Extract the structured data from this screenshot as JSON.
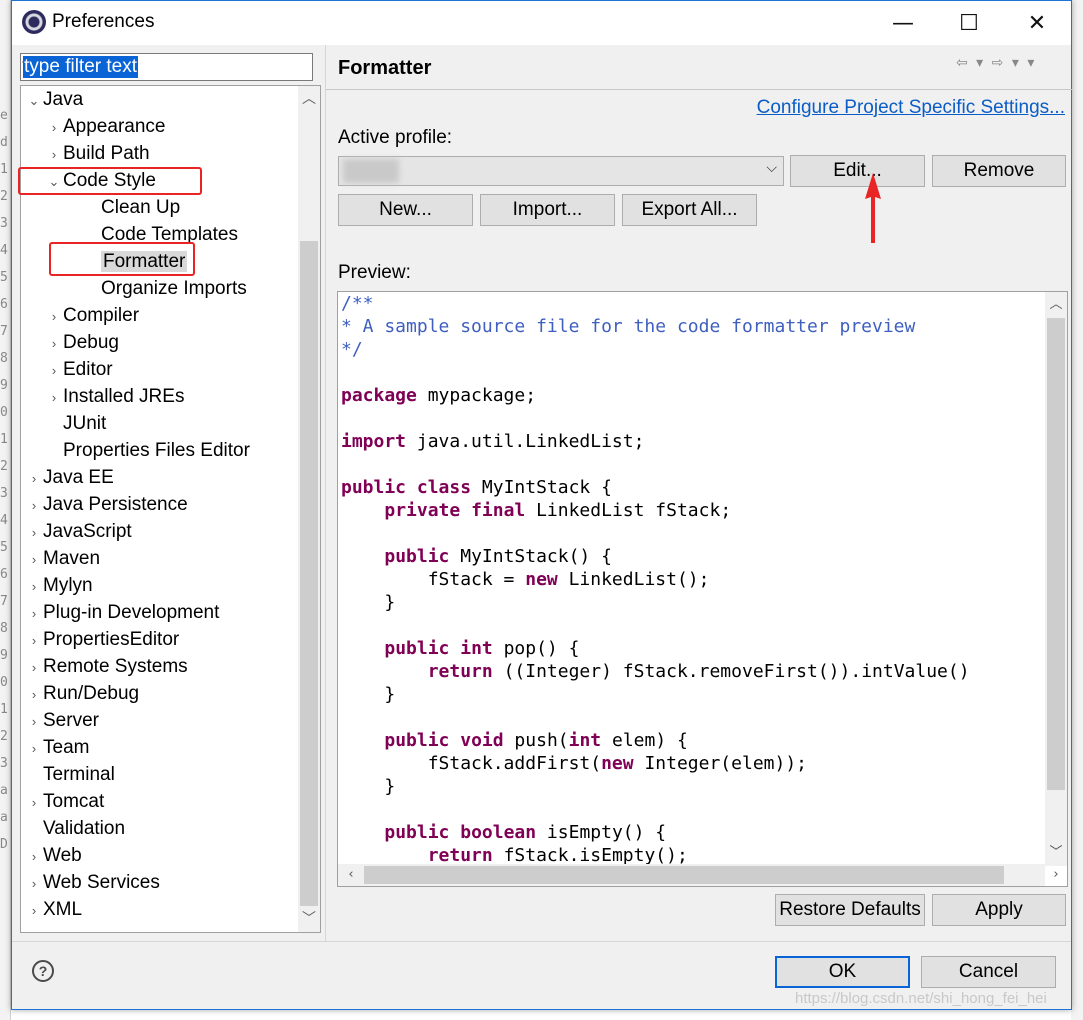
{
  "window": {
    "title": "Preferences",
    "minimize": "—",
    "maximize": "☐",
    "close": "✕"
  },
  "filter": {
    "placeholder": "type filter text",
    "value": "type filter text"
  },
  "tree": [
    {
      "label": "Java",
      "chevron": "⌄",
      "level": 0
    },
    {
      "label": "Appearance",
      "chevron": "›",
      "level": 1
    },
    {
      "label": "Build Path",
      "chevron": "›",
      "level": 1
    },
    {
      "label": "Code Style",
      "chevron": "⌄",
      "level": 1
    },
    {
      "label": "Clean Up",
      "chevron": "",
      "level": 2
    },
    {
      "label": "Code Templates",
      "chevron": "",
      "level": 2
    },
    {
      "label": "Formatter",
      "chevron": "",
      "level": 2,
      "selected": true
    },
    {
      "label": "Organize Imports",
      "chevron": "",
      "level": 2
    },
    {
      "label": "Compiler",
      "chevron": "›",
      "level": 1
    },
    {
      "label": "Debug",
      "chevron": "›",
      "level": 1
    },
    {
      "label": "Editor",
      "chevron": "›",
      "level": 1
    },
    {
      "label": "Installed JREs",
      "chevron": "›",
      "level": 1
    },
    {
      "label": "JUnit",
      "chevron": "",
      "level": 1
    },
    {
      "label": "Properties Files Editor",
      "chevron": "",
      "level": 1
    },
    {
      "label": "Java EE",
      "chevron": "›",
      "level": 0
    },
    {
      "label": "Java Persistence",
      "chevron": "›",
      "level": 0
    },
    {
      "label": "JavaScript",
      "chevron": "›",
      "level": 0
    },
    {
      "label": "Maven",
      "chevron": "›",
      "level": 0
    },
    {
      "label": "Mylyn",
      "chevron": "›",
      "level": 0
    },
    {
      "label": "Plug-in Development",
      "chevron": "›",
      "level": 0
    },
    {
      "label": "PropertiesEditor",
      "chevron": "›",
      "level": 0
    },
    {
      "label": "Remote Systems",
      "chevron": "›",
      "level": 0
    },
    {
      "label": "Run/Debug",
      "chevron": "›",
      "level": 0
    },
    {
      "label": "Server",
      "chevron": "›",
      "level": 0
    },
    {
      "label": "Team",
      "chevron": "›",
      "level": 0
    },
    {
      "label": "Terminal",
      "chevron": "",
      "level": 0
    },
    {
      "label": "Tomcat",
      "chevron": "›",
      "level": 0
    },
    {
      "label": "Validation",
      "chevron": "",
      "level": 0
    },
    {
      "label": "Web",
      "chevron": "›",
      "level": 0
    },
    {
      "label": "Web Services",
      "chevron": "›",
      "level": 0
    },
    {
      "label": "XML",
      "chevron": "›",
      "level": 0
    }
  ],
  "page": {
    "title": "Formatter",
    "nav": "⇦ ▾ ⇨ ▾ ▾",
    "configure_link": "Configure Project Specific Settings...",
    "active_profile_label": "Active profile:",
    "edit": "Edit...",
    "remove": "Remove",
    "new": "New...",
    "import": "Import...",
    "export_all": "Export All...",
    "preview_label": "Preview:"
  },
  "preview_code": [
    [
      {
        "t": "/**",
        "s": "c"
      }
    ],
    [
      {
        "t": "* A sample source file for the code formatter preview",
        "s": "c"
      }
    ],
    [
      {
        "t": "*/",
        "s": "c"
      }
    ],
    [],
    [
      {
        "t": "package",
        "s": "k"
      },
      {
        "t": " mypackage;",
        "s": ""
      }
    ],
    [],
    [
      {
        "t": "import",
        "s": "k"
      },
      {
        "t": " java.util.LinkedList;",
        "s": ""
      }
    ],
    [],
    [
      {
        "t": "public",
        "s": "k"
      },
      {
        "t": " ",
        "s": ""
      },
      {
        "t": "class",
        "s": "k"
      },
      {
        "t": " MyIntStack {",
        "s": ""
      }
    ],
    [
      {
        "t": "    ",
        "s": ""
      },
      {
        "t": "private",
        "s": "k"
      },
      {
        "t": " ",
        "s": ""
      },
      {
        "t": "final",
        "s": "k"
      },
      {
        "t": " LinkedList fStack;",
        "s": ""
      }
    ],
    [],
    [
      {
        "t": "    ",
        "s": ""
      },
      {
        "t": "public",
        "s": "k"
      },
      {
        "t": " MyIntStack() {",
        "s": ""
      }
    ],
    [
      {
        "t": "        fStack = ",
        "s": ""
      },
      {
        "t": "new",
        "s": "k"
      },
      {
        "t": " LinkedList();",
        "s": ""
      }
    ],
    [
      {
        "t": "    }",
        "s": ""
      }
    ],
    [],
    [
      {
        "t": "    ",
        "s": ""
      },
      {
        "t": "public",
        "s": "k"
      },
      {
        "t": " ",
        "s": ""
      },
      {
        "t": "int",
        "s": "k"
      },
      {
        "t": " pop() {",
        "s": ""
      }
    ],
    [
      {
        "t": "        ",
        "s": ""
      },
      {
        "t": "return",
        "s": "k"
      },
      {
        "t": " ((Integer) fStack.removeFirst()).intValue()",
        "s": ""
      }
    ],
    [
      {
        "t": "    }",
        "s": ""
      }
    ],
    [],
    [
      {
        "t": "    ",
        "s": ""
      },
      {
        "t": "public",
        "s": "k"
      },
      {
        "t": " ",
        "s": ""
      },
      {
        "t": "void",
        "s": "k"
      },
      {
        "t": " push(",
        "s": ""
      },
      {
        "t": "int",
        "s": "k"
      },
      {
        "t": " elem) {",
        "s": ""
      }
    ],
    [
      {
        "t": "        fStack.addFirst(",
        "s": ""
      },
      {
        "t": "new",
        "s": "k"
      },
      {
        "t": " Integer(elem));",
        "s": ""
      }
    ],
    [
      {
        "t": "    }",
        "s": ""
      }
    ],
    [],
    [
      {
        "t": "    ",
        "s": ""
      },
      {
        "t": "public",
        "s": "k"
      },
      {
        "t": " ",
        "s": ""
      },
      {
        "t": "boolean",
        "s": "k"
      },
      {
        "t": " isEmpty() {",
        "s": ""
      }
    ],
    [
      {
        "t": "        ",
        "s": ""
      },
      {
        "t": "return",
        "s": "k"
      },
      {
        "t": " fStack.isEmpty();",
        "s": ""
      }
    ]
  ],
  "footer": {
    "restore_defaults": "Restore Defaults",
    "apply": "Apply",
    "ok": "OK",
    "cancel": "Cancel",
    "help": "?",
    "watermark": "https://blog.csdn.net/shi_hong_fei_hei"
  },
  "background_line_numbers": [
    "e",
    "d",
    "1",
    "2",
    "3",
    "4",
    "5",
    "6",
    "7",
    "8",
    "9",
    "0",
    "1",
    "2",
    "3",
    "4",
    "5",
    "6",
    "7",
    "8",
    "9",
    "0",
    "1",
    "2",
    "3",
    "a",
    "a",
    "D"
  ],
  "colors": {
    "accent": "#0a64d6",
    "link": "#0a5cc6",
    "keyword": "#7f0055",
    "comment": "#3f5fbf",
    "annotation_red": "#e82424"
  }
}
